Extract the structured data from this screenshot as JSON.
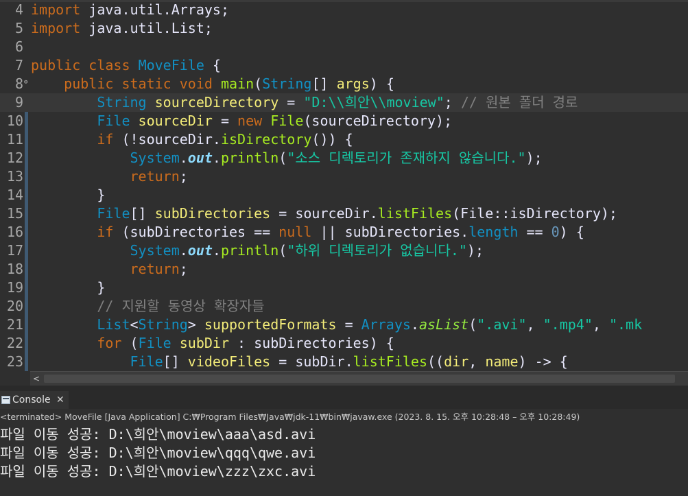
{
  "editor": {
    "lines": [
      {
        "n": "4",
        "segs": [
          [
            "kw",
            "import"
          ],
          [
            "op",
            " java.util.Arrays;"
          ]
        ]
      },
      {
        "n": "5",
        "segs": [
          [
            "kw",
            "import"
          ],
          [
            "op",
            " java.util.List;"
          ]
        ]
      },
      {
        "n": "6",
        "segs": []
      },
      {
        "n": "7",
        "segs": [
          [
            "kw",
            "public"
          ],
          [
            "op",
            " "
          ],
          [
            "kw",
            "class"
          ],
          [
            "op",
            " "
          ],
          [
            "cls",
            "MoveFile"
          ],
          [
            "op",
            " {"
          ]
        ]
      },
      {
        "n": "8",
        "fold": "⊖",
        "segs": [
          [
            "op",
            "    "
          ],
          [
            "kw",
            "public"
          ],
          [
            "op",
            " "
          ],
          [
            "kw",
            "static"
          ],
          [
            "op",
            " "
          ],
          [
            "kw",
            "void"
          ],
          [
            "op",
            " "
          ],
          [
            "fn",
            "main"
          ],
          [
            "op",
            "("
          ],
          [
            "ty",
            "String"
          ],
          [
            "op",
            "[] "
          ],
          [
            "var",
            "args"
          ],
          [
            "op",
            ") {"
          ]
        ]
      },
      {
        "n": "9",
        "current": true,
        "segs": [
          [
            "op",
            "        "
          ],
          [
            "ty",
            "String"
          ],
          [
            "op",
            " "
          ],
          [
            "var",
            "sourceDirectory"
          ],
          [
            "op",
            " = "
          ],
          [
            "str",
            "\"D:\\\\희안\\\\moview\""
          ],
          [
            "op",
            "; "
          ],
          [
            "cm",
            "// 원본 폴더 경로"
          ]
        ]
      },
      {
        "n": "10",
        "mark": true,
        "segs": [
          [
            "op",
            "        "
          ],
          [
            "ty",
            "File"
          ],
          [
            "op",
            " "
          ],
          [
            "var",
            "sourceDir"
          ],
          [
            "op",
            " = "
          ],
          [
            "kw",
            "new"
          ],
          [
            "op",
            " "
          ],
          [
            "fn",
            "File"
          ],
          [
            "op",
            "(sourceDirectory);"
          ]
        ]
      },
      {
        "n": "11",
        "mark": true,
        "segs": [
          [
            "op",
            "        "
          ],
          [
            "kw",
            "if"
          ],
          [
            "op",
            " (!sourceDir."
          ],
          [
            "fn",
            "isDirectory"
          ],
          [
            "op",
            "()) {"
          ]
        ]
      },
      {
        "n": "12",
        "mark": true,
        "segs": [
          [
            "op",
            "            "
          ],
          [
            "ty",
            "System"
          ],
          [
            "op",
            "."
          ],
          [
            "st",
            "out"
          ],
          [
            "op",
            "."
          ],
          [
            "fn",
            "println"
          ],
          [
            "op",
            "("
          ],
          [
            "str",
            "\"소스 디렉토리가 존재하지 않습니다.\""
          ],
          [
            "op",
            ");"
          ]
        ]
      },
      {
        "n": "13",
        "mark": true,
        "segs": [
          [
            "op",
            "            "
          ],
          [
            "kw",
            "return"
          ],
          [
            "op",
            ";"
          ]
        ]
      },
      {
        "n": "14",
        "mark": true,
        "segs": [
          [
            "op",
            "        }"
          ]
        ]
      },
      {
        "n": "15",
        "mark": true,
        "segs": [
          [
            "op",
            "        "
          ],
          [
            "ty",
            "File"
          ],
          [
            "op",
            "[] "
          ],
          [
            "var",
            "subDirectories"
          ],
          [
            "op",
            " = sourceDir."
          ],
          [
            "fn",
            "listFiles"
          ],
          [
            "op",
            "(File::isDirectory);"
          ]
        ]
      },
      {
        "n": "16",
        "mark": true,
        "segs": [
          [
            "op",
            "        "
          ],
          [
            "kw",
            "if"
          ],
          [
            "op",
            " (subDirectories == "
          ],
          [
            "kw",
            "null"
          ],
          [
            "op",
            " || subDirectories."
          ],
          [
            "ty",
            "length"
          ],
          [
            "op",
            " == "
          ],
          [
            "num",
            "0"
          ],
          [
            "op",
            ") {"
          ]
        ]
      },
      {
        "n": "17",
        "mark": true,
        "segs": [
          [
            "op",
            "            "
          ],
          [
            "ty",
            "System"
          ],
          [
            "op",
            "."
          ],
          [
            "st",
            "out"
          ],
          [
            "op",
            "."
          ],
          [
            "fn",
            "println"
          ],
          [
            "op",
            "("
          ],
          [
            "str",
            "\"하위 디렉토리가 없습니다.\""
          ],
          [
            "op",
            ");"
          ]
        ]
      },
      {
        "n": "18",
        "mark": true,
        "segs": [
          [
            "op",
            "            "
          ],
          [
            "kw",
            "return"
          ],
          [
            "op",
            ";"
          ]
        ]
      },
      {
        "n": "19",
        "mark": true,
        "segs": [
          [
            "op",
            "        }"
          ]
        ]
      },
      {
        "n": "20",
        "mark": true,
        "segs": [
          [
            "op",
            "        "
          ],
          [
            "cm",
            "// 지원할 동영상 확장자들"
          ]
        ]
      },
      {
        "n": "21",
        "mark": true,
        "segs": [
          [
            "op",
            "        "
          ],
          [
            "ty",
            "List"
          ],
          [
            "op",
            "<"
          ],
          [
            "ty",
            "String"
          ],
          [
            "op",
            "> "
          ],
          [
            "var",
            "supportedFormats"
          ],
          [
            "op",
            " = "
          ],
          [
            "ty",
            "Arrays"
          ],
          [
            "op",
            "."
          ],
          [
            "sm",
            "asList"
          ],
          [
            "op",
            "("
          ],
          [
            "str",
            "\".avi\""
          ],
          [
            "op",
            ", "
          ],
          [
            "str",
            "\".mp4\""
          ],
          [
            "op",
            ", "
          ],
          [
            "str",
            "\".mk"
          ]
        ]
      },
      {
        "n": "22",
        "mark": true,
        "segs": [
          [
            "op",
            "        "
          ],
          [
            "kw",
            "for"
          ],
          [
            "op",
            " ("
          ],
          [
            "ty",
            "File"
          ],
          [
            "op",
            " "
          ],
          [
            "var",
            "subDir"
          ],
          [
            "op",
            " : subDirectories) {"
          ]
        ]
      },
      {
        "n": "23",
        "mark": true,
        "segs": [
          [
            "op",
            "            "
          ],
          [
            "ty",
            "File"
          ],
          [
            "op",
            "[] "
          ],
          [
            "var",
            "videoFiles"
          ],
          [
            "op",
            " = subDir."
          ],
          [
            "fn",
            "listFiles"
          ],
          [
            "op",
            "(("
          ],
          [
            "var",
            "dir"
          ],
          [
            "op",
            ", "
          ],
          [
            "var",
            "name"
          ],
          [
            "op",
            ") -> {"
          ]
        ]
      }
    ]
  },
  "scrollbar": {
    "left_arrow": "<"
  },
  "console": {
    "tab_label": "Console",
    "close_glyph": "✕",
    "status": "<terminated> MoveFile [Java Application] C:₩Program Files₩Java₩jdk-11₩bin₩javaw.exe  (2023. 8. 15. 오후 10:28:48 – 오후 10:28:49)",
    "output": [
      "파일 이동 성공: D:\\희안\\moview\\aaa\\asd.avi",
      "파일 이동 성공: D:\\희안\\moview\\qqq\\qwe.avi",
      "파일 이동 성공: D:\\희안\\moview\\zzz\\zxc.avi"
    ]
  },
  "colors": {
    "background": "#2f2f2f",
    "keyword": "#cc6c1d",
    "type": "#1290c3",
    "string": "#17c6a3",
    "method": "#a7ec21",
    "variable": "#f3ec79"
  }
}
